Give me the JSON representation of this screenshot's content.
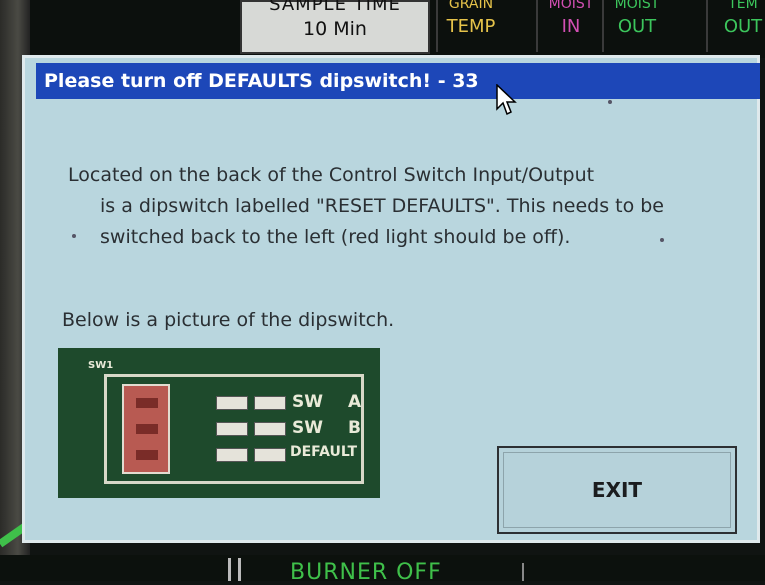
{
  "background": {
    "sample_time_label": "SAMPLE TIME",
    "sample_time_value": "10 Min",
    "headers": [
      {
        "top": "GRAIN",
        "bottom": "TEMP"
      },
      {
        "top": "MOIST",
        "bottom": "IN"
      },
      {
        "top": "MOIST",
        "bottom": "OUT"
      },
      {
        "top": "TEM",
        "bottom": "OUT"
      }
    ],
    "footer_status": "BURNER OFF"
  },
  "dialog": {
    "title": "Please turn off DEFAULTS dipswitch! - 33",
    "lines": [
      "Located on the back of the Control Switch Input/Output",
      "is a dipswitch labelled \"RESET DEFAULTS\".  This needs to be",
      "switched back to the left (red light should be off).",
      "Below is a picture of the dipswitch."
    ],
    "picture_labels": {
      "sw_header": "SW1",
      "row_a": "SW",
      "row_a_suffix": "A",
      "row_b": "SW",
      "row_b_suffix": "B",
      "row_c": "DEFAULT"
    },
    "exit_label": "EXIT"
  },
  "colors": {
    "titlebar": "#1d47b8",
    "dialog_bg": "#b9d6de",
    "temp": "#e6c34a",
    "moist_in": "#d24fb3",
    "out": "#3cc55c"
  }
}
